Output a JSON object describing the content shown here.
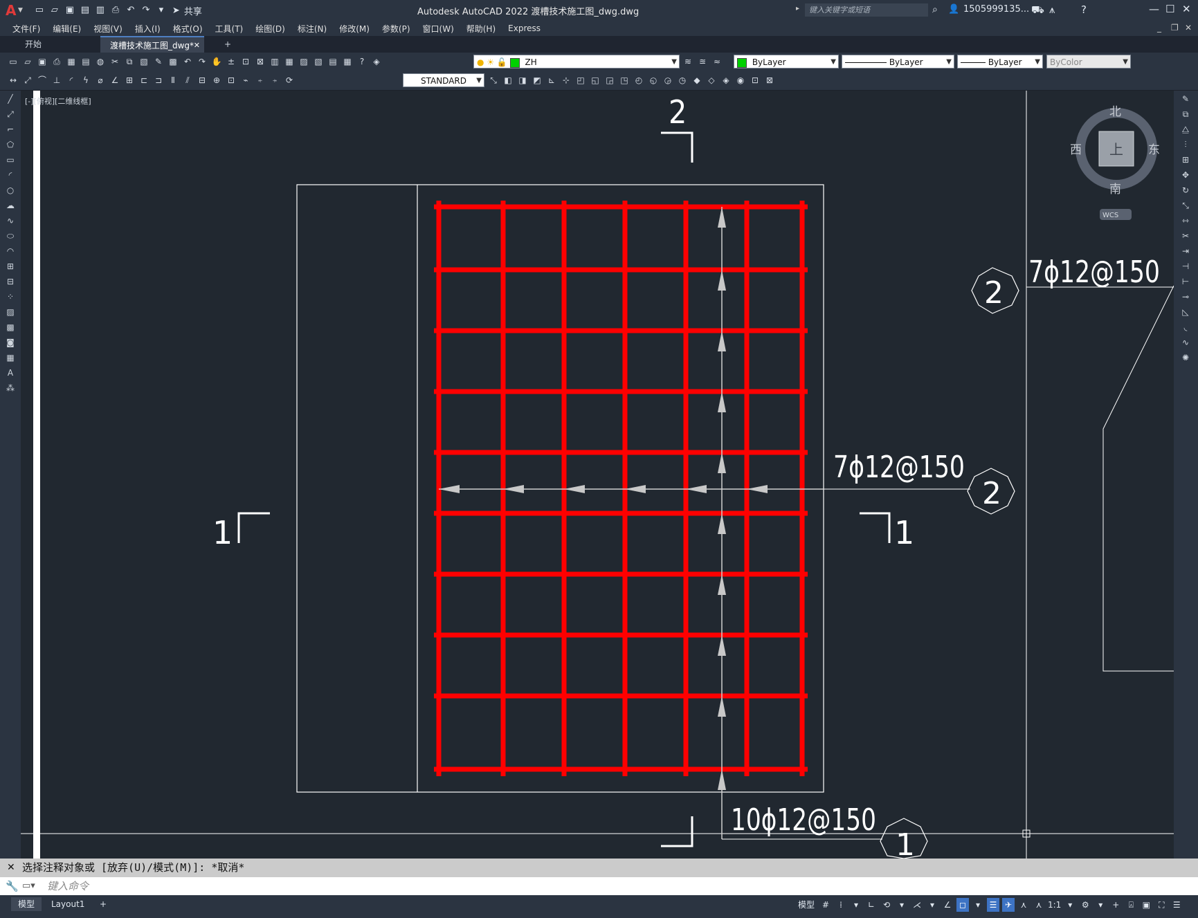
{
  "app": {
    "logo": "A",
    "title": "Autodesk AutoCAD 2022    渡槽技术施工图_dwg.dwg",
    "share_label": "共享",
    "search_placeholder": "键入关键字或短语",
    "user": "1505999135...",
    "help": "?"
  },
  "quick_access_icons": [
    "new-icon",
    "open-icon",
    "save-icon",
    "save-as-icon",
    "publish-icon",
    "plot-icon",
    "undo-icon",
    "redo-icon",
    "workspace-icon"
  ],
  "menu": [
    "文件(F)",
    "编辑(E)",
    "视图(V)",
    "插入(I)",
    "格式(O)",
    "工具(T)",
    "绘图(D)",
    "标注(N)",
    "修改(M)",
    "参数(P)",
    "窗口(W)",
    "帮助(H)",
    "Express"
  ],
  "tabs": [
    {
      "label": "开始"
    },
    {
      "label": "渡槽技术施工图_dwg*"
    }
  ],
  "properties": {
    "layer": "ZH",
    "color": "ByLayer",
    "linetype": "ByLayer",
    "lineweight": "ByLayer",
    "plotstyle": "ByColor",
    "textstyle": "STANDARD"
  },
  "viewport_label": "[-][俯视][二维线框]",
  "viewcube": {
    "north": "北",
    "south": "南",
    "east": "东",
    "west": "西",
    "top": "上",
    "wcs": "WCS"
  },
  "drawing": {
    "section_2_top": "2",
    "section_1_left": "1",
    "section_1_right": "1",
    "rebar_label_h": "7ϕ12@150",
    "rebar_label_v": "10ϕ12@150",
    "rebar_label_right": "7ϕ12@150",
    "callout_2_a": "2",
    "callout_2_b": "2",
    "callout_1": "1"
  },
  "command": {
    "history": "选择注释对象或 [放弃(U)/模式(M)]: *取消*",
    "placeholder": "键入命令"
  },
  "status": {
    "tabs": [
      "模型",
      "Layout1"
    ],
    "model_label": "模型",
    "scale": "1:1"
  },
  "colors": {
    "background": "#212830",
    "rebar": "#ff0000",
    "lines": "#ffffff"
  }
}
